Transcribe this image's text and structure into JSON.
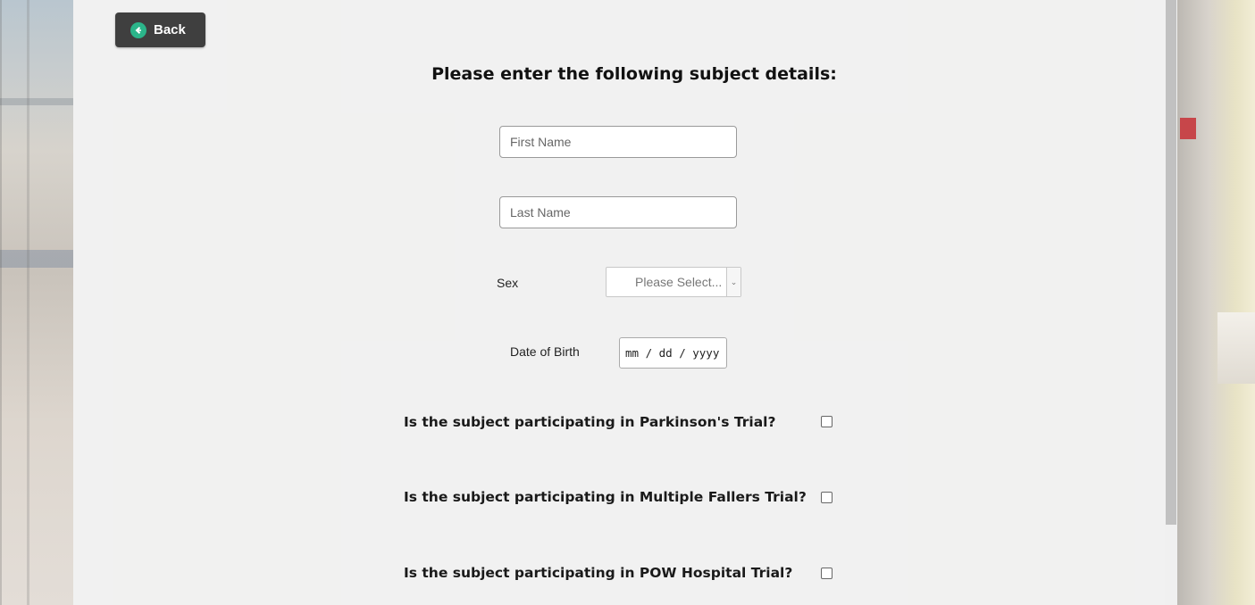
{
  "back_button": {
    "label": "Back",
    "icon": "arrow-left-circle-icon",
    "icon_color": "#2bb58a"
  },
  "form": {
    "heading": "Please enter the following subject details:",
    "first_name": {
      "placeholder": "First Name",
      "value": ""
    },
    "last_name": {
      "placeholder": "Last Name",
      "value": ""
    },
    "sex": {
      "label": "Sex",
      "selected": "Please Select..."
    },
    "dob": {
      "label": "Date of Birth",
      "value": "mm / dd / yyyy"
    },
    "questions": [
      {
        "text": "Is the subject participating in Parkinson's Trial?",
        "checked": false
      },
      {
        "text": "Is the subject participating in Multiple Fallers Trial?",
        "checked": false
      },
      {
        "text": "Is the subject participating in POW Hospital Trial?",
        "checked": false
      }
    ]
  },
  "colors": {
    "button_bg": "#3f3f3f",
    "panel_bg": "#f3f3f3"
  }
}
